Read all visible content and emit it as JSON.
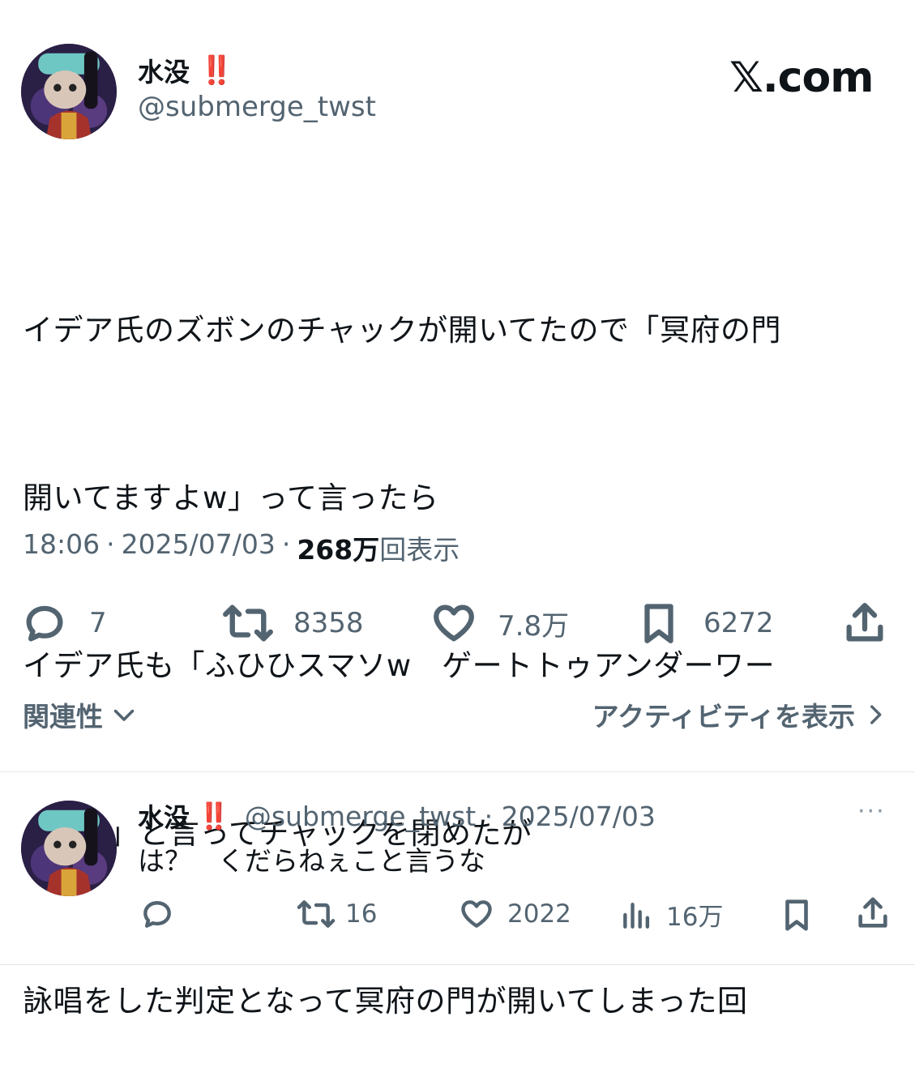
{
  "header": {
    "display_name": "水没",
    "badge": "‼️",
    "handle": "@submerge_twst",
    "watermark": "𝕏.com"
  },
  "tweet": {
    "lines": [
      "イデア氏のズボンのチャックが開いてたので「冥府の門",
      "開いてますよw」って言ったら",
      "イデア氏も「ふひひスマソw　ゲートトゥアンダーワー",
      "ルドw」と言ってチャックを閉めたが",
      "詠唱をした判定となって冥府の門が開いてしまった回"
    ],
    "time": "18:06",
    "separator": "·",
    "date": "2025/07/03",
    "views_count": "268万",
    "views_label": "回表示"
  },
  "actions": {
    "replies": "7",
    "retweets": "8358",
    "likes": "7.8万",
    "bookmarks": "6272"
  },
  "footer": {
    "relevance_label": "関連性",
    "activity_label": "アクティビティを表示"
  },
  "reply": {
    "display_name": "水没",
    "badge": "‼️",
    "handle_date": "@submerge_twst · 2025/07/03",
    "more": "···",
    "text": "は？　くだらねぇこと言うな",
    "retweets": "16",
    "likes": "2022",
    "views": "16万"
  }
}
